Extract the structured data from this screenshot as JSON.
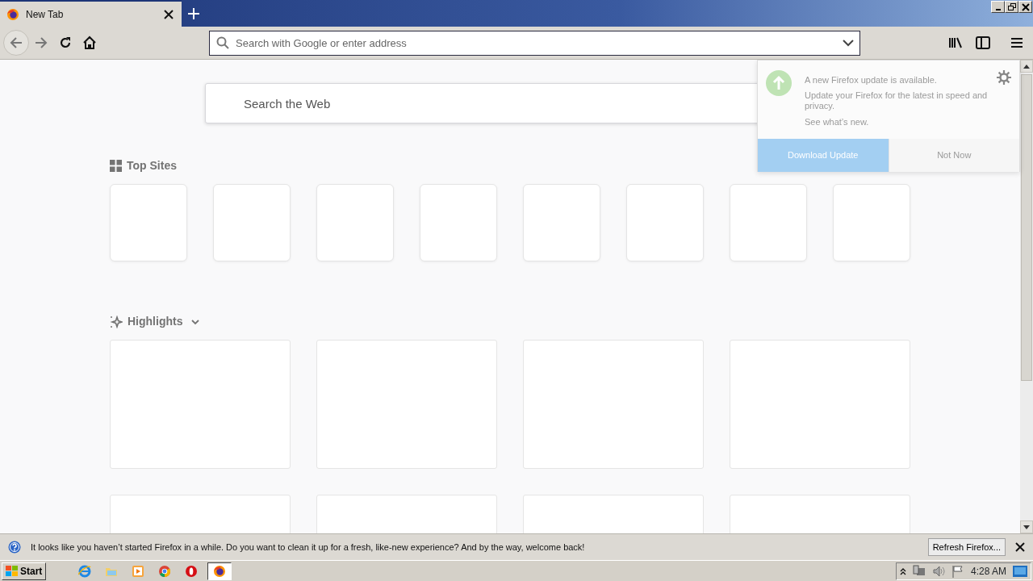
{
  "tabs": [
    {
      "title": "New Tab",
      "selected": true
    }
  ],
  "address_bar": {
    "placeholder": "Search with Google or enter address"
  },
  "search": {
    "placeholder": "Search the Web"
  },
  "top_sites": {
    "heading": "Top Sites",
    "tiles": [
      {
        "kind": "empty"
      },
      {
        "kind": "empty"
      },
      {
        "kind": "empty"
      },
      {
        "kind": "empty"
      },
      {
        "kind": "empty"
      },
      {
        "kind": "empty"
      },
      {
        "kind": "empty"
      },
      {
        "kind": "empty"
      }
    ]
  },
  "highlights": {
    "heading": "Highlights",
    "expanded": true,
    "cards": [
      {
        "kind": "empty"
      },
      {
        "kind": "empty"
      },
      {
        "kind": "empty"
      },
      {
        "kind": "empty"
      },
      {
        "kind": "empty"
      },
      {
        "kind": "empty"
      },
      {
        "kind": "empty"
      },
      {
        "kind": "empty"
      }
    ]
  },
  "update_panel": {
    "title": "A new Firefox update is available.",
    "body": "Update your Firefox for the latest in speed and privacy.",
    "link": "See what’s new.",
    "primary_button": "Download Update",
    "secondary_button": "Not Now"
  },
  "notification_bar": {
    "message": "It looks like you haven’t started Firefox in a while. Do you want to clean it up for a fresh, like-new experience? And by the way, welcome back!",
    "button": "Refresh Firefox..."
  },
  "taskbar": {
    "start": "Start",
    "apps": [
      {
        "kind": "ie",
        "selected": false
      },
      {
        "kind": "folder",
        "selected": false
      },
      {
        "kind": "media",
        "selected": false
      },
      {
        "kind": "chrome",
        "selected": false
      },
      {
        "kind": "opera",
        "selected": false
      },
      {
        "kind": "firefox",
        "selected": true
      }
    ],
    "clock": "4:28 AM"
  }
}
